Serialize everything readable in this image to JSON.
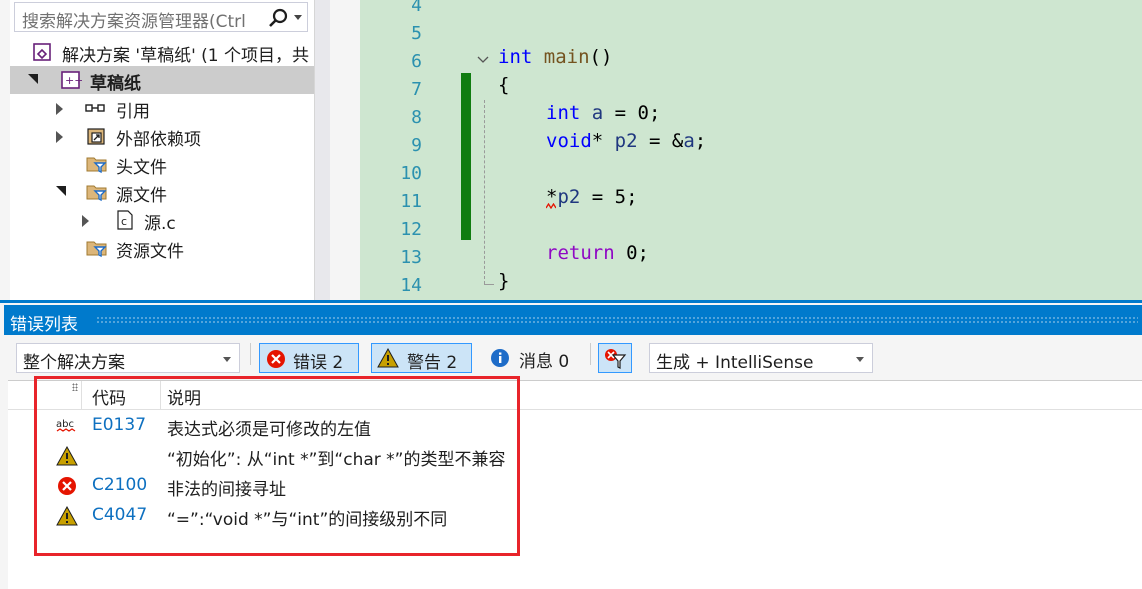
{
  "solution_explorer": {
    "search_placeholder": "搜索解决方案资源管理器(Ctrl",
    "solution_label": "解决方案 '草稿纸' (1 个项目，共",
    "project_label": "草稿纸",
    "items": [
      {
        "label": "引用",
        "icon": "references-icon"
      },
      {
        "label": "外部依赖项",
        "icon": "external-deps-icon"
      },
      {
        "label": "头文件",
        "icon": "filter-folder-icon"
      },
      {
        "label": "源文件",
        "icon": "filter-folder-icon"
      },
      {
        "label": "源.c",
        "icon": "c-file-icon"
      },
      {
        "label": "资源文件",
        "icon": "filter-folder-icon"
      }
    ]
  },
  "editor": {
    "line_numbers": [
      "4",
      "5",
      "6",
      "7",
      "8",
      "9",
      "10",
      "11",
      "12",
      "13",
      "14"
    ],
    "lines": {
      "l6_kw": "int",
      "l6_fn": "main",
      "l6_rest": "()",
      "l7": "{",
      "l8_kw": "int",
      "l8_var": "a",
      "l8_rest": " = 0;",
      "l9_kw": "void",
      "l9_mid": "* ",
      "l9_var": "p2",
      "l9_rest": " = &",
      "l9_var2": "a",
      "l9_end": ";",
      "l11_star": "*",
      "l11_var": "p2",
      "l11_rest": " = 5;",
      "l13_kw": "return",
      "l13_rest": " 0;",
      "l14": "}"
    }
  },
  "error_list": {
    "title": "错误列表",
    "scope_combo": "整个解决方案",
    "errors_btn": "错误 2",
    "warnings_btn": "警告 2",
    "messages_btn": "消息 0",
    "source_combo": "生成 + IntelliSense",
    "columns": {
      "code": "代码",
      "description": "说明"
    },
    "rows": [
      {
        "type": "intellisense",
        "code": "E0137",
        "description": "表达式必须是可修改的左值"
      },
      {
        "type": "warning",
        "code": "",
        "description": "“初始化”: 从“int *”到“char *”的类型不兼容"
      },
      {
        "type": "error",
        "code": "C2100",
        "description": "非法的间接寻址"
      },
      {
        "type": "warning",
        "code": "C4047",
        "description": "“=”:“void *”与“int”的间接级别不同"
      }
    ]
  },
  "colors": {
    "accent": "#007acc",
    "editor_bg": "#cee6d0",
    "change_bar": "#107c10",
    "highlight_box": "#e8242a",
    "error_red": "#e51400",
    "warning_yellow": "#c8a000"
  }
}
